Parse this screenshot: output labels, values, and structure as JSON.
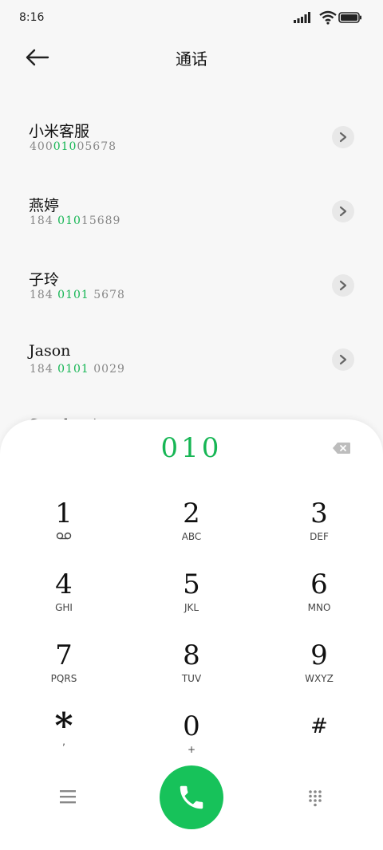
{
  "status": {
    "time": "8:16"
  },
  "header": {
    "title": "通话"
  },
  "contacts": [
    {
      "name": "小米客服",
      "num_pre": "400",
      "num_hl": "010",
      "num_post": "05678"
    },
    {
      "name": "燕婷",
      "num_pre": "184 ",
      "num_hl": "010",
      "num_post": "15689"
    },
    {
      "name": "子玲",
      "num_pre": "184 ",
      "num_hl": "0101",
      "num_post": " 5678"
    },
    {
      "name": "Jason",
      "num_pre": "184 ",
      "num_hl": "0101",
      "num_post": " 0029"
    },
    {
      "name": "Stephanie",
      "num_pre": "",
      "num_hl": "",
      "num_post": ""
    }
  ],
  "dialer": {
    "entry": "010",
    "keys": [
      {
        "digit": "1",
        "letters": ""
      },
      {
        "digit": "2",
        "letters": "ABC"
      },
      {
        "digit": "3",
        "letters": "DEF"
      },
      {
        "digit": "4",
        "letters": "GHI"
      },
      {
        "digit": "5",
        "letters": "JKL"
      },
      {
        "digit": "6",
        "letters": "MNO"
      },
      {
        "digit": "7",
        "letters": "PQRS"
      },
      {
        "digit": "8",
        "letters": "TUV"
      },
      {
        "digit": "9",
        "letters": "WXYZ"
      },
      {
        "digit": "*",
        "letters": ","
      },
      {
        "digit": "0",
        "letters": "+"
      },
      {
        "digit": "#",
        "letters": ""
      }
    ]
  },
  "colors": {
    "accent": "#17b655",
    "call_button": "#17c25a"
  },
  "icons": {
    "back": "arrow-left-icon",
    "row_arrow": "chevron-right-icon",
    "delete": "backspace-icon",
    "voicemail": "voicemail-icon",
    "menu": "menu-icon",
    "call": "phone-icon",
    "keypad": "keypad-icon"
  }
}
